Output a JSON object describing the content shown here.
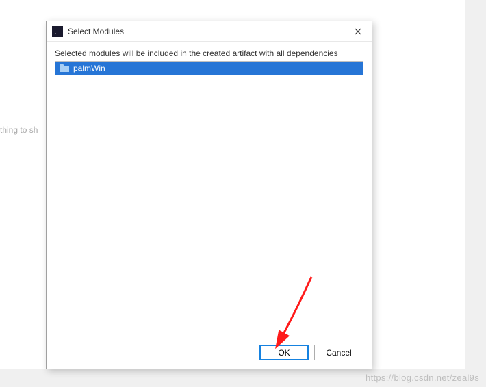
{
  "background": {
    "placeholder_text": "thing to sh"
  },
  "dialog": {
    "title": "Select Modules",
    "info": "Selected modules will be included in the created artifact with all dependencies",
    "items": [
      {
        "label": "palmWin",
        "selected": true
      }
    ],
    "buttons": {
      "ok": "OK",
      "cancel": "Cancel"
    }
  },
  "watermark": "https://blog.csdn.net/zeal9s"
}
